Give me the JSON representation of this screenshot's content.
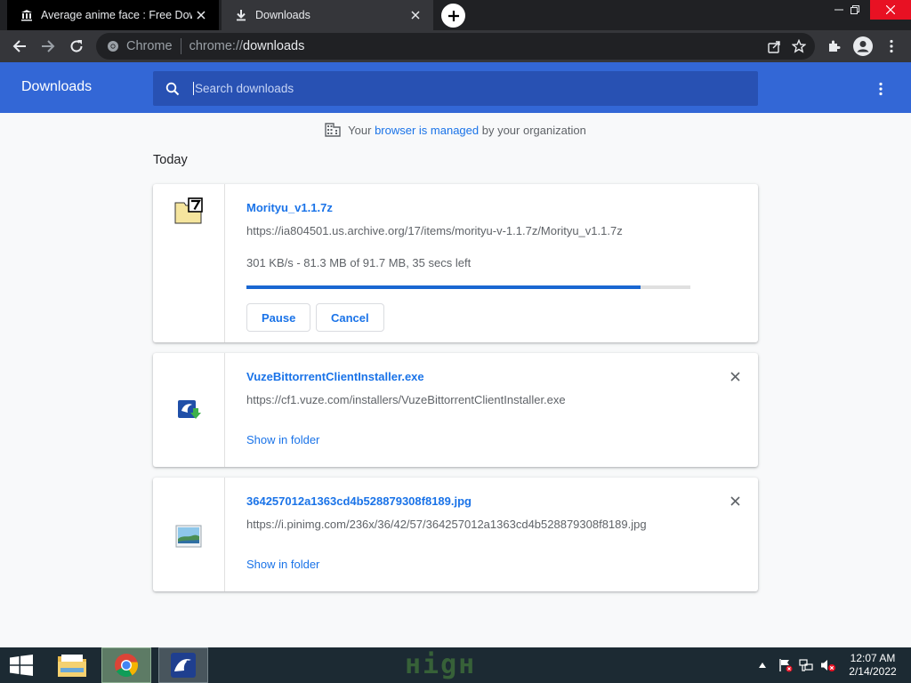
{
  "tabs": [
    {
      "title": "Average anime face : Free Downl",
      "icon": "archive-icon",
      "active": false
    },
    {
      "title": "Downloads",
      "icon": "download-icon",
      "active": true
    }
  ],
  "omnibox": {
    "scheme_label": "Chrome",
    "scheme": "chrome://",
    "host": "downloads"
  },
  "header": {
    "title": "Downloads",
    "search_placeholder": "Search downloads"
  },
  "managed": {
    "prefix": "Your ",
    "link": "browser is managed",
    "suffix": " by your organization"
  },
  "section": "Today",
  "downloads": [
    {
      "name": "Morityu_v1.1.7z",
      "url": "https://ia804501.us.archive.org/17/items/morityu-v-1.1.7z/Morityu_v1.1.7z",
      "status": "301 KB/s - 81.3 MB of 91.7 MB, 35 secs left",
      "progress_fraction": 0.887,
      "buttons": [
        "Pause",
        "Cancel"
      ],
      "icon": "7z-archive-icon"
    },
    {
      "name": "VuzeBittorrentClientInstaller.exe",
      "url": "https://cf1.vuze.com/installers/VuzeBittorrentClientInstaller.exe",
      "link": "Show in folder",
      "icon": "vuze-installer-icon"
    },
    {
      "name": "364257012a1363cd4b528879308f8189.jpg",
      "url": "https://i.pinimg.com/236x/36/42/57/364257012a1363cd4b528879308f8189.jpg",
      "link": "Show in folder",
      "icon": "image-file-icon"
    }
  ],
  "taskbar": {
    "time": "12:07 AM",
    "date": "2/14/2022",
    "watermark": "ніgн"
  },
  "colors": {
    "header_blue": "#3367d6",
    "link_blue": "#1a73e8",
    "progress": "#1967d2"
  }
}
